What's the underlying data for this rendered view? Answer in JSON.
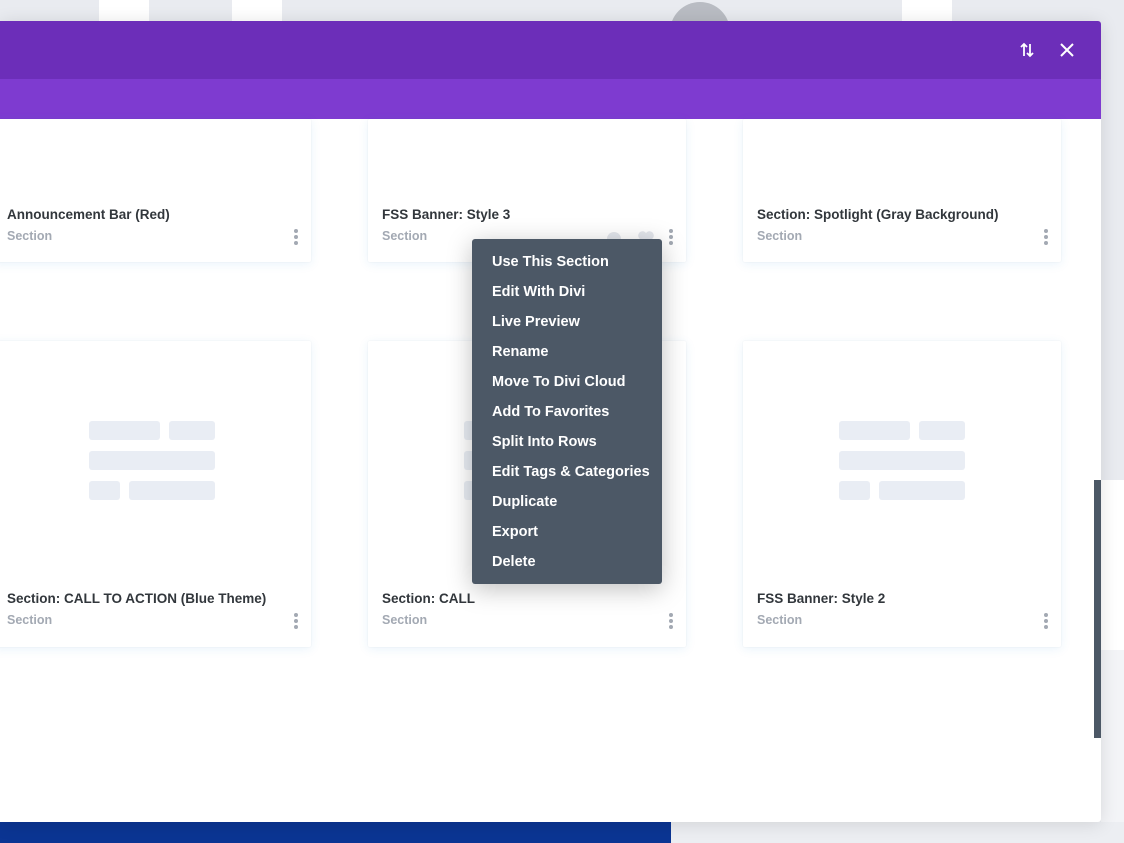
{
  "modal": {
    "header_icons": {
      "sort": "sort-arrows-icon",
      "close": "close-icon"
    }
  },
  "cards_row1": [
    {
      "title": "Announcement Bar (Red)",
      "type": "Section"
    },
    {
      "title": "FSS Banner: Style 3",
      "type": "Section"
    },
    {
      "title": "Section: Spotlight (Gray Background)",
      "type": "Section"
    }
  ],
  "cards_row2": [
    {
      "title": "Section: CALL TO ACTION (Blue Theme)",
      "type": "Section"
    },
    {
      "title": "Section: CALL",
      "type": "Section"
    },
    {
      "title": "FSS Banner: Style 2",
      "type": "Section"
    }
  ],
  "context_menu": {
    "items": [
      "Use This Section",
      "Edit With Divi",
      "Live Preview",
      "Rename",
      "Move To Divi Cloud",
      "Add To Favorites",
      "Split Into Rows",
      "Edit Tags & Categories",
      "Duplicate",
      "Export",
      "Delete"
    ]
  },
  "colors": {
    "header": "#6c2eb9",
    "subbar": "#7e3bd0",
    "menu_bg": "#4c5866",
    "bottom_bar": "#0b3593"
  }
}
